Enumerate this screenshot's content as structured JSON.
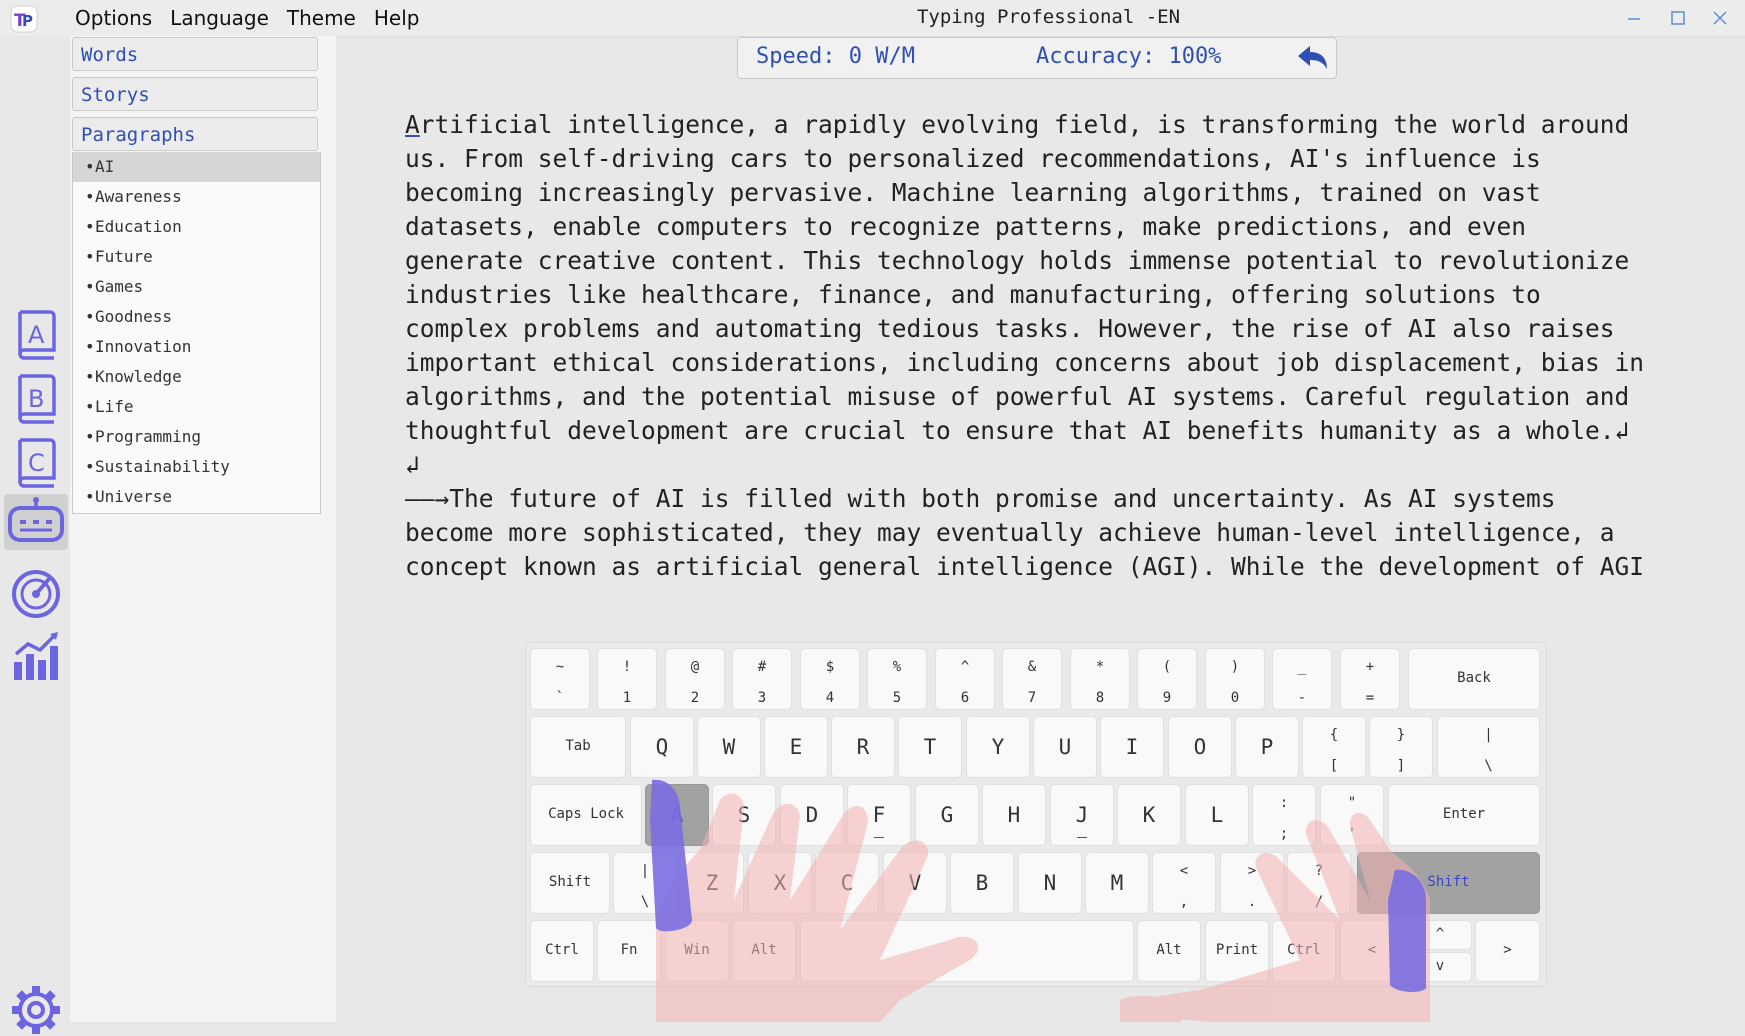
{
  "window": {
    "title": "Typing Professional -EN"
  },
  "menu": [
    "Options",
    "Language",
    "Theme",
    "Help"
  ],
  "sidebar": {
    "categories": [
      "Words",
      "Storys",
      "Paragraphs"
    ],
    "paragraphs": [
      "AI",
      "Awareness",
      "Education",
      "Future",
      "Games",
      "Goodness",
      "Innovation",
      "Knowledge",
      "Life",
      "Programming",
      "Sustainability",
      "Universe"
    ],
    "selected": "AI"
  },
  "stats": {
    "speed": "Speed: 0 W/M",
    "accuracy": "Accuracy: 100%"
  },
  "text": {
    "first_char": "A",
    "lines": [
      "rtificial intelligence, a rapidly evolving field, is transforming the world around",
      "us. From self-driving cars to personalized recommendations, AI's influence is",
      "becoming increasingly pervasive. Machine learning algorithms, trained on vast",
      "datasets, enable computers to recognize patterns, make predictions, and even",
      "generate creative content. This technology holds immense potential to revolutionize",
      "industries like healthcare, finance, and manufacturing, offering solutions to",
      "complex problems and automating tedious tasks. However, the rise of AI also raises",
      "important ethical considerations, including concerns about job displacement, bias in",
      "algorithms, and the potential misuse of powerful AI systems. Careful regulation and",
      "thoughtful development are crucial to ensure that AI benefits humanity as a whole.↲",
      "↲",
      "——→The future of AI is filled with both promise and uncertainty. As AI systems",
      "become more sophisticated, they may eventually achieve human-level intelligence, a",
      "concept known as artificial general intelligence (AGI). While the development of AGI"
    ]
  },
  "keyboard": {
    "row1": [
      [
        "~",
        "`"
      ],
      [
        "!",
        "1"
      ],
      [
        "@",
        "2"
      ],
      [
        "#",
        "3"
      ],
      [
        "$",
        "4"
      ],
      [
        "%",
        "5"
      ],
      [
        "^",
        "6"
      ],
      [
        "&",
        "7"
      ],
      [
        "*",
        "8"
      ],
      [
        "(",
        "9"
      ],
      [
        ")",
        "0"
      ],
      [
        "_",
        "-"
      ],
      [
        "+",
        "="
      ]
    ],
    "row1_back": "Back",
    "row2_tab": "Tab",
    "row2_letters": [
      "Q",
      "W",
      "E",
      "R",
      "T",
      "Y",
      "U",
      "I",
      "O",
      "P"
    ],
    "row2_syms": [
      [
        "{",
        "["
      ],
      [
        "}",
        "]"
      ],
      [
        "|",
        "\\"
      ]
    ],
    "row3_caps": "Caps Lock",
    "row3_letters": [
      "A",
      "S",
      "D",
      "F",
      "G",
      "H",
      "J",
      "K",
      "L"
    ],
    "row3_syms": [
      [
        ":",
        ";"
      ],
      [
        "\"",
        "'"
      ]
    ],
    "row3_enter": "Enter",
    "row4_lshift": "Shift",
    "row4_bar": [
      "|",
      "\\"
    ],
    "row4_letters": [
      "Z",
      "X",
      "C",
      "V",
      "B",
      "N",
      "M"
    ],
    "row4_syms": [
      [
        "<",
        ","
      ],
      [
        ">",
        "."
      ],
      [
        "?",
        "/"
      ]
    ],
    "row4_rshift": "Shift",
    "row5": {
      "ctrl": "Ctrl",
      "fn": "Fn",
      "win": "Win",
      "alt": "Alt",
      "ralt": "Alt",
      "print": "Print",
      "rctrl": "Ctrl",
      "left": "<",
      "up": "^",
      "down": "v",
      "right": ">"
    },
    "highlighted": [
      "A",
      "Shift"
    ],
    "colors": {
      "finger_active": "#7a6ee0",
      "finger": "#f0b3b3",
      "highlight": "#a2a2a2",
      "accent": "#2f4fb5"
    }
  },
  "icons": [
    "book-a-icon",
    "book-b-icon",
    "book-c-icon",
    "robot-icon",
    "speedometer-icon",
    "chart-icon",
    "gear-icon"
  ]
}
